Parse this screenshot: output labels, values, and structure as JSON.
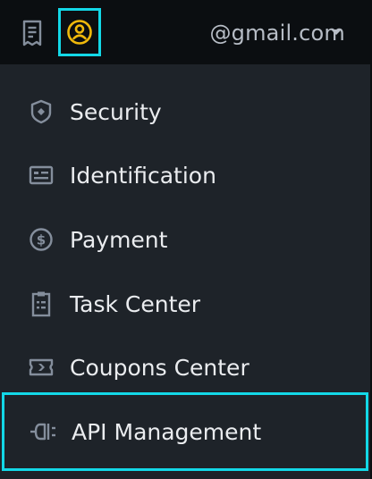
{
  "header": {
    "email": "@gmail.com",
    "icons": {
      "orders": "receipt-icon",
      "account": "user-circle-icon",
      "dropdown": "caret-down-icon"
    }
  },
  "menu": {
    "items": [
      {
        "label": "Security",
        "icon": "shield-icon"
      },
      {
        "label": "Identification",
        "icon": "id-card-icon"
      },
      {
        "label": "Payment",
        "icon": "dollar-circle-icon"
      },
      {
        "label": "Task Center",
        "icon": "clipboard-icon"
      },
      {
        "label": "Coupons Center",
        "icon": "ticket-icon"
      },
      {
        "label": "API Management",
        "icon": "api-plug-icon"
      }
    ],
    "selected_index": 5
  },
  "colors": {
    "background": "#0b0e11",
    "menu_background": "#1e2329",
    "text": "#eaecef",
    "muted": "#848e9c",
    "accent_yellow": "#f0b90b",
    "highlight": "#13d8e7"
  }
}
